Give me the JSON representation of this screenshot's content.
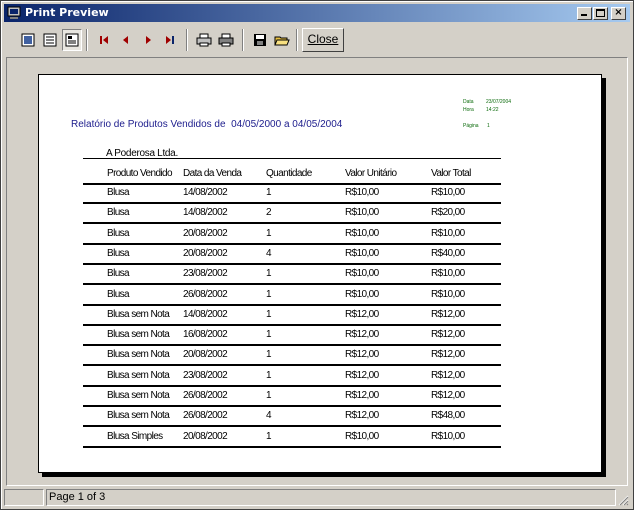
{
  "window": {
    "title": "Print Preview"
  },
  "toolbar": {
    "buttons": [
      {
        "name": "one-page-icon",
        "glyph": "▣"
      },
      {
        "name": "two-pages-icon",
        "glyph": "▤"
      },
      {
        "name": "zoom-page-icon",
        "glyph": "▦"
      },
      {
        "name": "first-page-icon",
        "glyph": "❙◀"
      },
      {
        "name": "prev-page-icon",
        "glyph": "◀"
      },
      {
        "name": "next-page-icon",
        "glyph": "▶"
      },
      {
        "name": "last-page-icon",
        "glyph": "▶❙"
      },
      {
        "name": "print-setup-icon",
        "glyph": "⎙"
      },
      {
        "name": "print-icon",
        "glyph": "⎙"
      },
      {
        "name": "save-icon",
        "glyph": "▪"
      },
      {
        "name": "open-icon",
        "glyph": "📂"
      }
    ],
    "close_label": "Close"
  },
  "report": {
    "title": "Relatório de Produtos Vendidos de",
    "date_range": "04/05/2000 a 04/05/2004",
    "meta": {
      "date_label": "Data",
      "date_value": "23/07/2004",
      "time_label": "Hora",
      "time_value": "14:22",
      "page_label": "Página",
      "page_value": "1"
    },
    "company": "A Poderosa Ltda.",
    "columns": [
      "Produto Vendido",
      "Data da Venda",
      "Quantidade",
      "Valor Unitário",
      "Valor Total"
    ],
    "rows": [
      [
        "Blusa",
        "14/08/2002",
        "1",
        "R$10,00",
        "R$10,00"
      ],
      [
        "Blusa",
        "14/08/2002",
        "2",
        "R$10,00",
        "R$20,00"
      ],
      [
        "Blusa",
        "20/08/2002",
        "1",
        "R$10,00",
        "R$10,00"
      ],
      [
        "Blusa",
        "20/08/2002",
        "4",
        "R$10,00",
        "R$40,00"
      ],
      [
        "Blusa",
        "23/08/2002",
        "1",
        "R$10,00",
        "R$10,00"
      ],
      [
        "Blusa",
        "26/08/2002",
        "1",
        "R$10,00",
        "R$10,00"
      ],
      [
        "Blusa sem Nota",
        "14/08/2002",
        "1",
        "R$12,00",
        "R$12,00"
      ],
      [
        "Blusa sem Nota",
        "16/08/2002",
        "1",
        "R$12,00",
        "R$12,00"
      ],
      [
        "Blusa sem Nota",
        "20/08/2002",
        "1",
        "R$12,00",
        "R$12,00"
      ],
      [
        "Blusa sem Nota",
        "23/08/2002",
        "1",
        "R$12,00",
        "R$12,00"
      ],
      [
        "Blusa sem Nota",
        "26/08/2002",
        "1",
        "R$12,00",
        "R$12,00"
      ],
      [
        "Blusa sem Nota",
        "26/08/2002",
        "4",
        "R$12,00",
        "R$48,00"
      ],
      [
        "Blusa Simples",
        "20/08/2002",
        "1",
        "R$10,00",
        "R$10,00"
      ]
    ]
  },
  "status": {
    "page_text": "Page 1 of 3"
  },
  "colors": {
    "title_bar_start": "#0a246a",
    "title_bar_end": "#a6caf0",
    "report_title": "#1c1c8c",
    "meta_text": "#0a6a0a"
  }
}
